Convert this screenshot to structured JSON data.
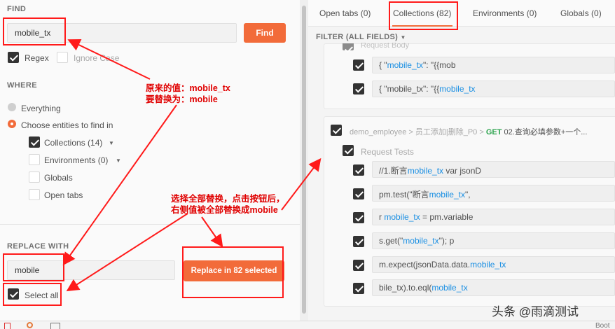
{
  "find": {
    "title": "FIND",
    "value": "mobile_tx",
    "button": "Find",
    "regex": "Regex",
    "ignore_case": "Ignore Case"
  },
  "where": {
    "title": "WHERE",
    "everything": "Everything",
    "choose": "Choose entities to find in",
    "collections": "Collections (14)",
    "environments": "Environments (0)",
    "globals": "Globals",
    "open_tabs": "Open tabs"
  },
  "replace": {
    "title": "REPLACE WITH",
    "value": "mobile",
    "select_all": "Select all",
    "button": "Replace in 82 selected"
  },
  "tabs": [
    "Open tabs (0)",
    "Collections (82)",
    "Environments (0)",
    "Globals (0)"
  ],
  "filter": "FILTER (ALL FIELDS)",
  "results": {
    "section_body": "Request Body",
    "body_rows": [
      {
        "a": "{ \"",
        "b": "mobile_tx",
        "c": "\": \"{{mob"
      },
      {
        "a": "{ \"mobile_tx\": \"{{",
        "b": "mobile_tx",
        "c": ""
      }
    ],
    "crumb_path": "demo_employee > 员工添加|删除_P0 >",
    "crumb_method": "GET",
    "crumb_name": "02.查询必填参数+一个...",
    "section_tests": "Request Tests",
    "test_rows": [
      {
        "a": "//1.断言",
        "b": "mobile_tx",
        "c": " var jsonD"
      },
      {
        "a": "pm.test(\"断言",
        "b": "mobile_tx",
        "c": "\","
      },
      {
        "a": "r ",
        "b": "mobile_tx",
        "c": " = pm.variable"
      },
      {
        "a": "s.get(\"",
        "b": "mobile_tx",
        "c": "\"); p"
      },
      {
        "a": "m.expect(jsonData.data.",
        "b": "mobile_tx",
        "c": ""
      },
      {
        "a": "bile_tx).to.eql(",
        "b": "mobile_tx",
        "c": ""
      }
    ]
  },
  "annotations": {
    "note1_line1": "原来的值：mobile_tx",
    "note1_line2": "要替换为：mobile",
    "note2_line1": "选择全部替换，点击按钮后，",
    "note2_line2": "右侧值被全部替换成mobile"
  },
  "watermark": "头条 @雨滴测试",
  "status": "Boot",
  "colors": {
    "accent": "#f26b3a",
    "annotation": "#ff1a1a",
    "link": "#1a8fe3",
    "method_get": "#2ea44f"
  }
}
